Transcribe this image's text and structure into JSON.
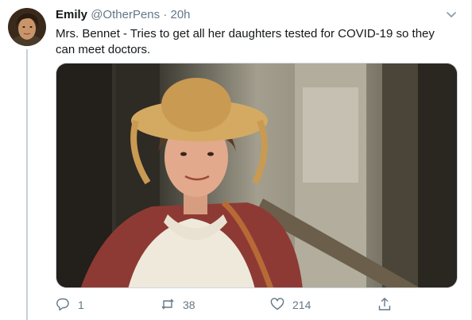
{
  "tweet": {
    "author_name": "Emily",
    "author_handle": "@OtherPens",
    "separator": "·",
    "timestamp": "20h",
    "text": "Mrs. Bennet - Tries to get all her daughters tested for COVID-19 so they can meet doctors.",
    "media_alt": "Photo of a smiling woman in a straw bonnet and period dress standing by a staircase"
  },
  "actions": {
    "reply_count": "1",
    "retweet_count": "38",
    "like_count": "214"
  },
  "icons": {
    "menu": "chevron-down-icon",
    "reply": "speech-bubble-icon",
    "retweet": "retweet-icon",
    "like": "heart-icon",
    "share": "share-icon"
  },
  "colors": {
    "text_primary": "#14171a",
    "text_secondary": "#657786",
    "divider": "#e6ecf0"
  }
}
